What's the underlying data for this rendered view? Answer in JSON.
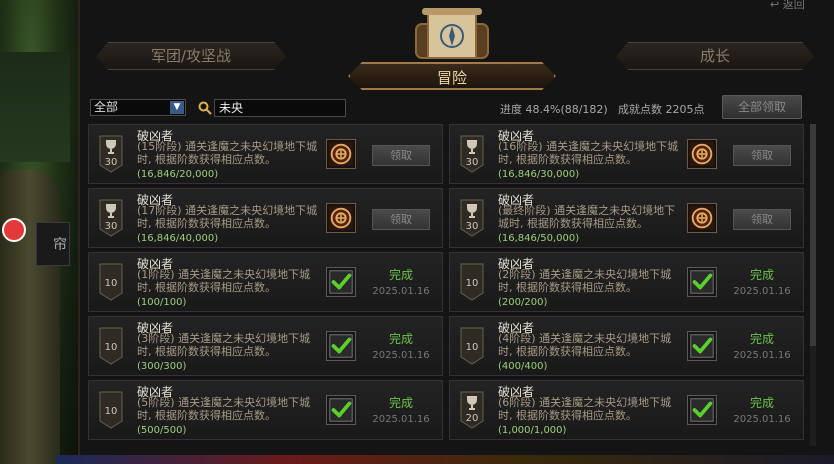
{
  "header": {
    "back_label": "返回",
    "tab_left": "军团/攻坚战",
    "tab_active": "冒险",
    "tab_right": "成长"
  },
  "filter": {
    "category": "全部",
    "search_value": "未央",
    "progress_text": "进度 48.4%(88/182)",
    "points_text": "成就点数 2205点",
    "claim_all_label": "全部领取"
  },
  "side": {
    "tab_label": "帘"
  },
  "achievements": [
    {
      "title": "破凶者",
      "desc": "(15阶段) 通关逢魔之未央幻境地下城时, 根据阶数获得相应点数。",
      "count": "(16,846/20,000)",
      "points": "30",
      "state": "claim",
      "action": "领取",
      "date": ""
    },
    {
      "title": "破凶者",
      "desc": "(16阶段) 通关逢魔之未央幻境地下城时, 根据阶数获得相应点数。",
      "count": "(16,846/30,000)",
      "points": "30",
      "state": "claim",
      "action": "领取",
      "date": ""
    },
    {
      "title": "破凶者",
      "desc": "(17阶段) 通关逢魔之未央幻境地下城时, 根据阶数获得相应点数。",
      "count": "(16,846/40,000)",
      "points": "30",
      "state": "claim",
      "action": "领取",
      "date": ""
    },
    {
      "title": "破凶者",
      "desc": "(最终阶段) 通关逢魔之未央幻境地下城时, 根据阶数获得相应点数。",
      "count": "(16,846/50,000)",
      "points": "30",
      "state": "claim",
      "action": "领取",
      "date": ""
    },
    {
      "title": "破凶者",
      "desc": "(1阶段) 通关逢魔之未央幻境地下城时, 根据阶数获得相应点数。",
      "count": "(100/100)",
      "points": "10",
      "state": "done",
      "action": "完成",
      "date": "2025.01.16"
    },
    {
      "title": "破凶者",
      "desc": "(2阶段) 通关逢魔之未央幻境地下城时, 根据阶数获得相应点数。",
      "count": "(200/200)",
      "points": "10",
      "state": "done",
      "action": "完成",
      "date": "2025.01.16"
    },
    {
      "title": "破凶者",
      "desc": "(3阶段) 通关逢魔之未央幻境地下城时, 根据阶数获得相应点数。",
      "count": "(300/300)",
      "points": "10",
      "state": "done",
      "action": "完成",
      "date": "2025.01.16"
    },
    {
      "title": "破凶者",
      "desc": "(4阶段) 通关逢魔之未央幻境地下城时, 根据阶数获得相应点数。",
      "count": "(400/400)",
      "points": "10",
      "state": "done",
      "action": "完成",
      "date": "2025.01.16"
    },
    {
      "title": "破凶者",
      "desc": "(5阶段) 通关逢魔之未央幻境地下城时, 根据阶数获得相应点数。",
      "count": "(500/500)",
      "points": "10",
      "state": "done",
      "action": "完成",
      "date": "2025.01.16"
    },
    {
      "title": "破凶者",
      "desc": "(6阶段) 通关逢魔之未央幻境地下城时, 根据阶数获得相应点数。",
      "count": "(1,000/1,000)",
      "points": "20",
      "state": "done",
      "action": "完成",
      "date": "2025.01.16"
    }
  ],
  "colors": {
    "accent": "#a07a4a",
    "done": "#6ac44a",
    "count": "#9ad07a"
  }
}
